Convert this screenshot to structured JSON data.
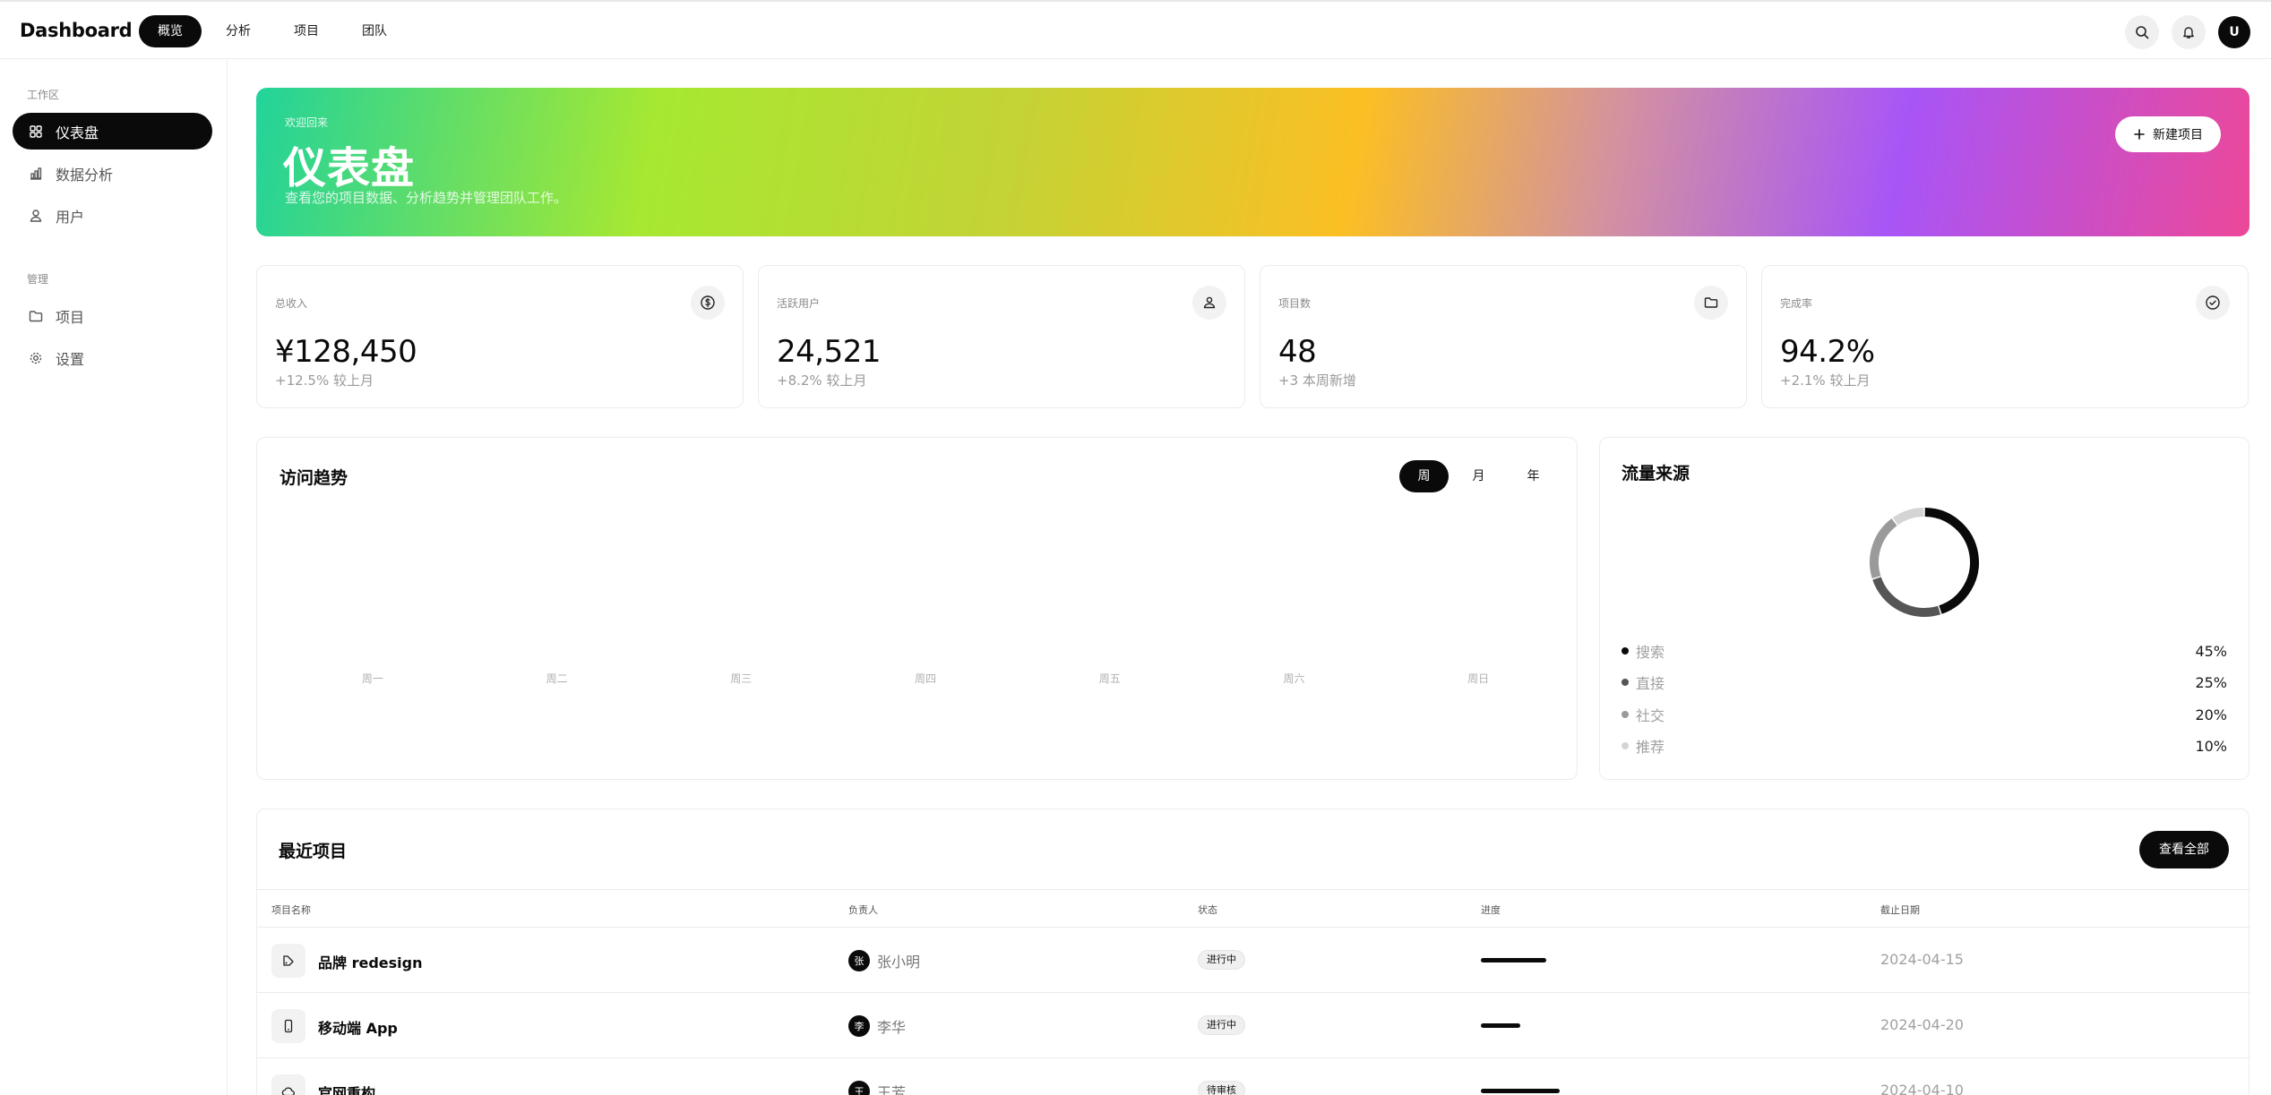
{
  "app": {
    "brand": "Dashboard"
  },
  "topnav": [
    {
      "label": "概览",
      "active": true
    },
    {
      "label": "分析",
      "active": false
    },
    {
      "label": "项目",
      "active": false
    },
    {
      "label": "团队",
      "active": false
    }
  ],
  "header": {
    "avatar_initial": "U",
    "icons": [
      "search-icon",
      "bell-icon"
    ]
  },
  "sidebar": {
    "group_workspace": "工作区",
    "group_manage": "管理",
    "items": [
      {
        "label": "仪表盘",
        "icon": "grid-icon",
        "active": true
      },
      {
        "label": "数据分析",
        "icon": "bar-chart-icon",
        "active": false
      },
      {
        "label": "用户",
        "icon": "users-icon",
        "active": false
      },
      {
        "label": "项目",
        "icon": "folder-icon",
        "active": false
      },
      {
        "label": "设置",
        "icon": "gear-icon",
        "active": false
      }
    ]
  },
  "hero": {
    "welcome": "欢迎回来",
    "title": "仪表盘",
    "subtitle": "查看您的项目数据、分析趋势并管理团队工作。",
    "button": "新建项目"
  },
  "stats": [
    {
      "label": "总收入",
      "value": "¥128,450",
      "change": "+12.5%",
      "period": "较上月",
      "icon": "currency-icon"
    },
    {
      "label": "活跃用户",
      "value": "24,521",
      "change": "+8.2%",
      "period": "较上月",
      "icon": "user-icon"
    },
    {
      "label": "项目数",
      "value": "48",
      "change": "+3",
      "period": "本周新增",
      "icon": "folder-icon"
    },
    {
      "label": "完成率",
      "value": "94.2%",
      "change": "+2.1%",
      "period": "较上月",
      "icon": "check-circle-icon"
    }
  ],
  "visits": {
    "title": "访问趋势",
    "ranges": [
      {
        "label": "周",
        "active": true
      },
      {
        "label": "月",
        "active": false
      },
      {
        "label": "年",
        "active": false
      }
    ],
    "xlabels": [
      "周一",
      "周二",
      "周三",
      "周四",
      "周五",
      "周六",
      "周日"
    ]
  },
  "traffic": {
    "title": "流量来源",
    "sources": [
      {
        "name": "搜索",
        "value": "45%",
        "share": 45,
        "color": "#0a0a0a"
      },
      {
        "name": "直接",
        "value": "25%",
        "share": 25,
        "color": "#555555"
      },
      {
        "name": "社交",
        "value": "20%",
        "share": 20,
        "color": "#9a9a9a"
      },
      {
        "name": "推荐",
        "value": "10%",
        "share": 10,
        "color": "#d4d4d4"
      }
    ]
  },
  "projects": {
    "title": "最近项目",
    "view_all": "查看全部",
    "columns": [
      "项目名称",
      "负责人",
      "状态",
      "进度",
      "截止日期"
    ],
    "rows": [
      {
        "name": "品牌 redesign",
        "icon": "palette-icon",
        "owner": "张小明",
        "owner_initial": "张",
        "status": "进行中",
        "progress": 0.75,
        "due": "2024-04-15"
      },
      {
        "name": "移动端 App",
        "icon": "phone-icon",
        "owner": "李华",
        "owner_initial": "李",
        "status": "进行中",
        "progress": 0.45,
        "due": "2024-04-20"
      },
      {
        "name": "官网重构",
        "icon": "cloud-icon",
        "owner": "王芳",
        "owner_initial": "王",
        "status": "待审核",
        "progress": 0.9,
        "due": "2024-04-10"
      }
    ]
  },
  "colors": {
    "accent": "#0a0a0a",
    "hero_gradient": [
      "#22d39a",
      "#a6e832",
      "#fbbf24",
      "#a855f7",
      "#ec4899"
    ]
  }
}
